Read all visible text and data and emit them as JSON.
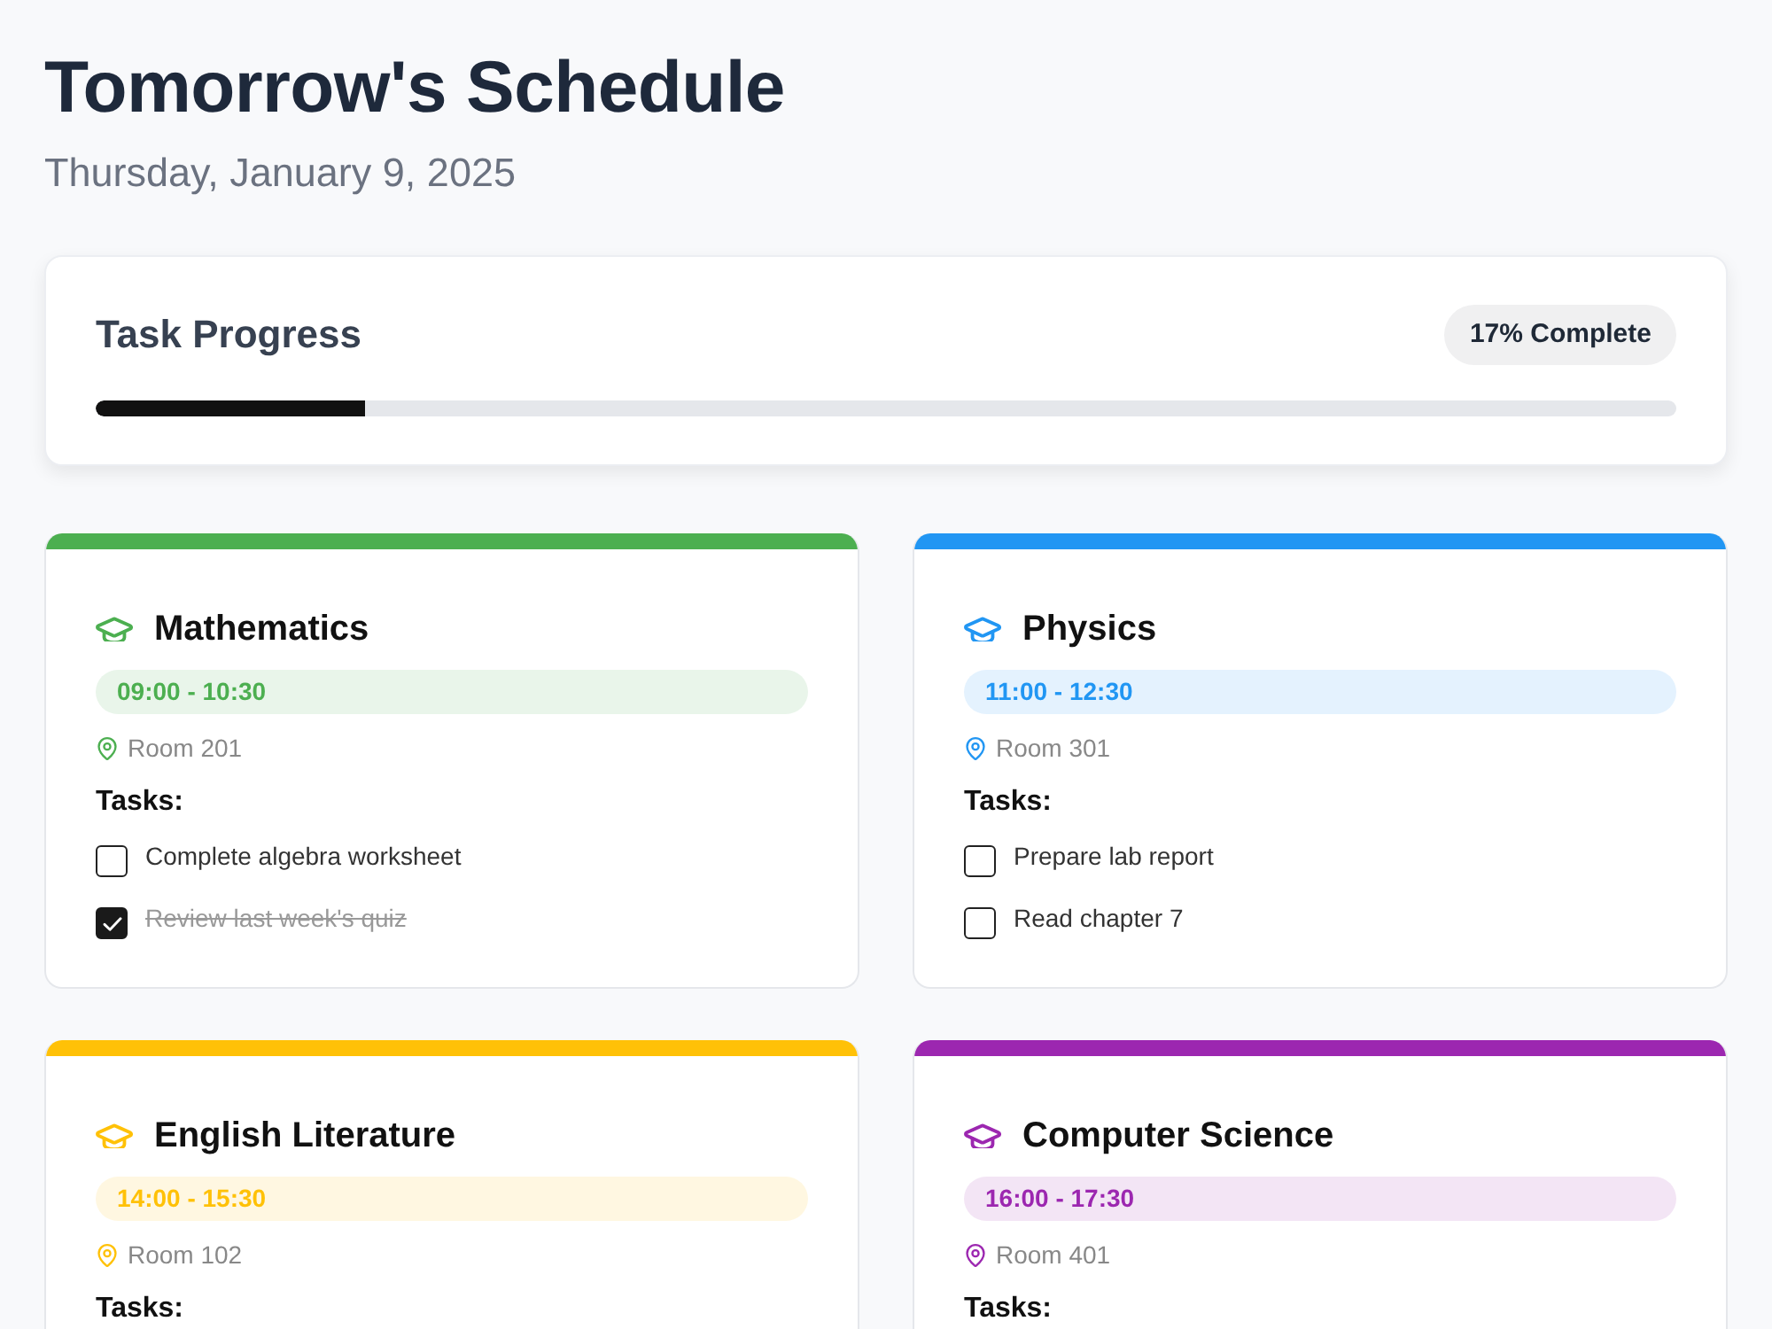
{
  "page": {
    "title": "Tomorrow's Schedule",
    "date": "Thursday, January 9, 2025"
  },
  "progress": {
    "title": "Task Progress",
    "badge": "17% Complete",
    "level": 0.17
  },
  "classes": [
    {
      "name": "Mathematics",
      "color": "#4caf50",
      "time": "09:00 - 10:30",
      "room": "Room 201",
      "tasks_label": "Tasks:",
      "tasks": [
        {
          "text": "Complete algebra worksheet",
          "checked": false
        },
        {
          "text": "Review last week's quiz",
          "checked": true
        }
      ]
    },
    {
      "name": "Physics",
      "color": "#2196f3",
      "time": "11:00 - 12:30",
      "room": "Room 301",
      "tasks_label": "Tasks:",
      "tasks": [
        {
          "text": "Prepare lab report",
          "checked": false
        },
        {
          "text": "Read chapter 7",
          "checked": false
        }
      ]
    },
    {
      "name": "English Literature",
      "color": "#ffc107",
      "time": "14:00 - 15:30",
      "room": "Room 102",
      "tasks_label": "Tasks:"
    },
    {
      "name": "Computer Science",
      "color": "#9c27b0",
      "time": "16:00 - 17:30",
      "room": "Room 401",
      "tasks_label": "Tasks:"
    }
  ]
}
